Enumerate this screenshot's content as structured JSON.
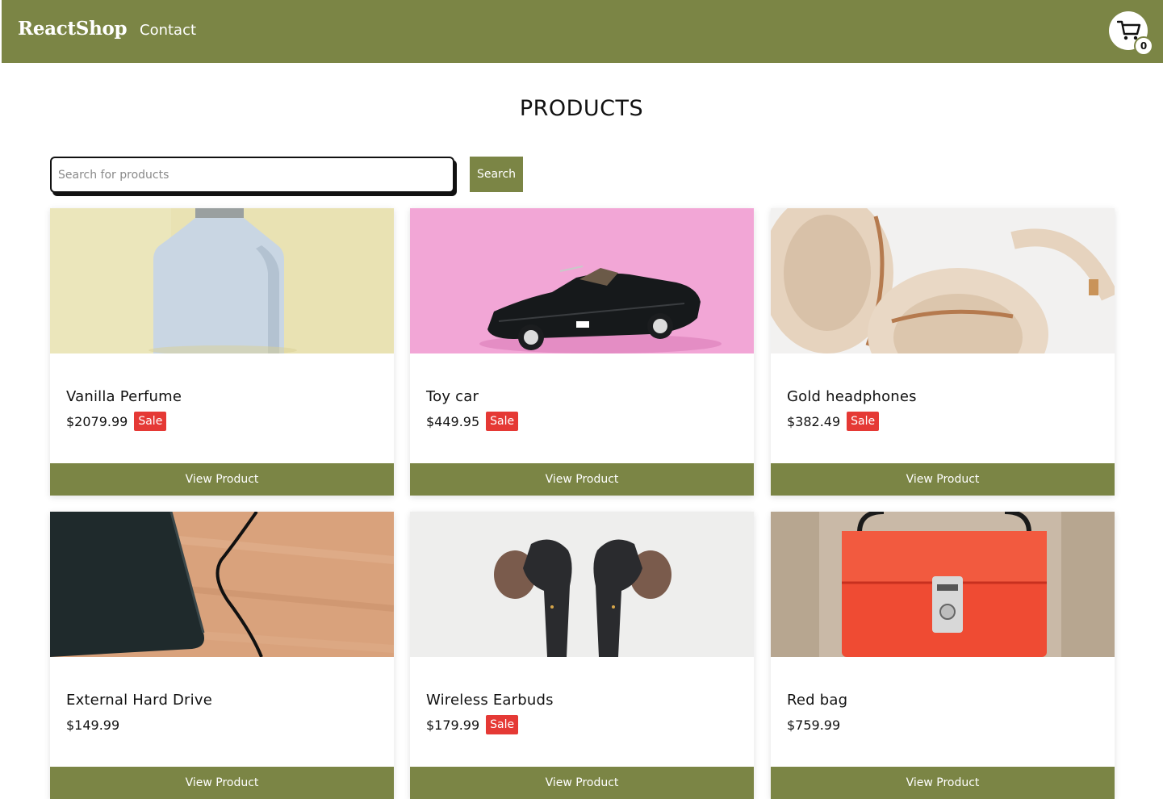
{
  "navbar": {
    "brand": "ReactShop",
    "links": [
      "Contact"
    ],
    "cart_count": "0",
    "background": "#7b8545"
  },
  "page_title": "PRODUCTS",
  "search": {
    "placeholder": "Search for products",
    "value": "",
    "button_label": "Search"
  },
  "products": [
    {
      "name": "Vanilla Perfume",
      "price": "$2079.99",
      "badge": "Sale",
      "button": "View Product",
      "image": "perfume-bottle-image"
    },
    {
      "name": "Toy car",
      "price": "$449.95",
      "badge": "Sale",
      "button": "View Product",
      "image": "toy-car-image"
    },
    {
      "name": "Gold headphones",
      "price": "$382.49",
      "badge": "Sale",
      "button": "View Product",
      "image": "headphones-image"
    },
    {
      "name": "External Hard Drive",
      "price": "$149.99",
      "badge": "",
      "button": "View Product",
      "image": "hard-drive-image"
    },
    {
      "name": "Wireless Earbuds",
      "price": "$179.99",
      "badge": "Sale",
      "button": "View Product",
      "image": "earbuds-image"
    },
    {
      "name": "Red bag",
      "price": "$759.99",
      "badge": "",
      "button": "View Product",
      "image": "red-bag-image"
    }
  ],
  "colors": {
    "accent": "#7b8545",
    "sale": "#e53935"
  }
}
